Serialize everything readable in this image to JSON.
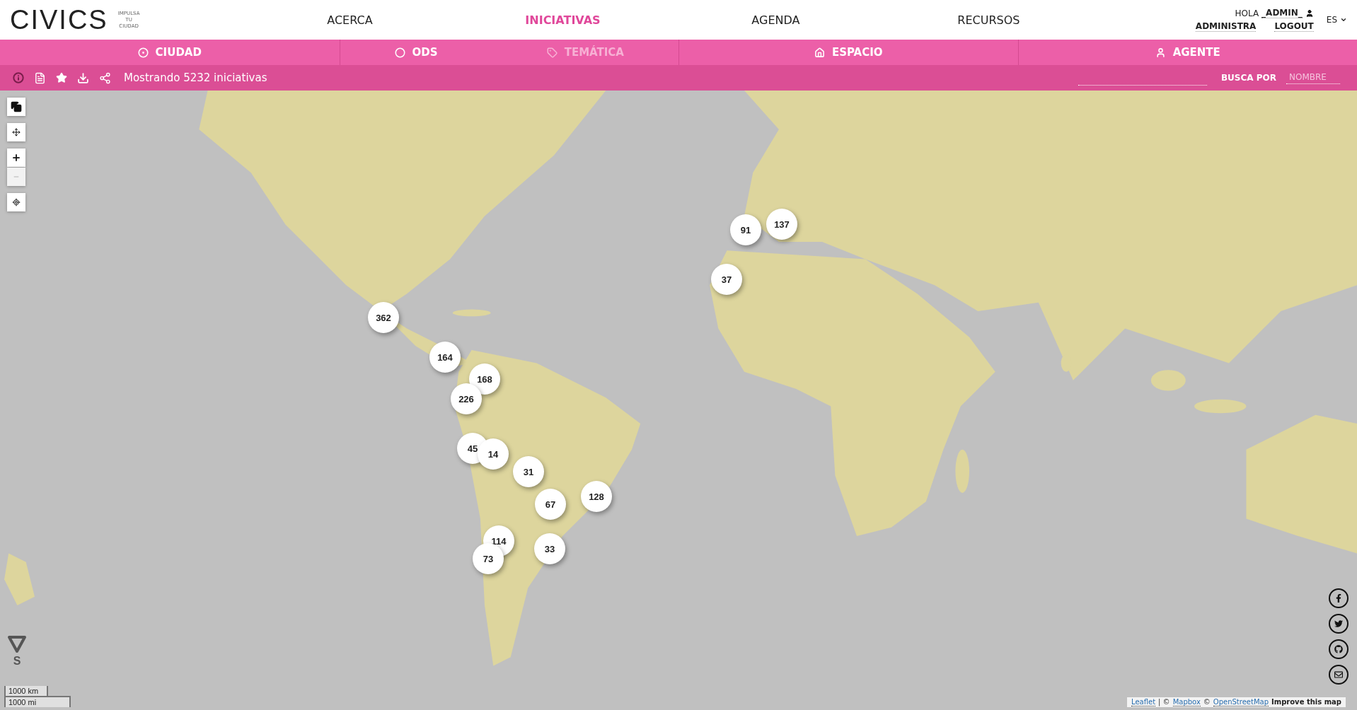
{
  "header": {
    "logo": "CIVICS",
    "tagline": [
      "IMPULSA",
      "TU",
      "CIUDAD"
    ],
    "nav": [
      {
        "label": "ACERCA",
        "selected": false
      },
      {
        "label": "INICIATIVAS",
        "selected": true
      },
      {
        "label": "AGENDA",
        "selected": false
      },
      {
        "label": "RECURSOS",
        "selected": false
      }
    ],
    "user": {
      "greeting": "HOLA",
      "name": "_ADMIN_",
      "links": [
        "ADMINISTRA",
        "LOGOUT"
      ]
    },
    "language": "ES"
  },
  "filters": [
    [
      {
        "label": "CIUDAD",
        "kind": "city",
        "dimmed": false
      }
    ],
    [
      {
        "label": "ODS",
        "kind": "ods",
        "dimmed": false
      },
      {
        "label": "TEMÁTICA",
        "kind": "topic",
        "dimmed": true
      }
    ],
    [
      {
        "label": "ESPACIO",
        "kind": "space",
        "dimmed": false
      }
    ],
    [
      {
        "label": "AGENTE",
        "kind": "agent",
        "dimmed": false
      }
    ]
  ],
  "toolbar": {
    "count": "Mostrando 5232 iniciativas",
    "search_label": "BUSCA POR",
    "search_by": "NOMBRE"
  },
  "map": {
    "clusters": [
      "362",
      "164",
      "168",
      "226",
      "45",
      "14",
      "31",
      "67",
      "128",
      "114",
      "73",
      "33",
      "91",
      "137",
      "37"
    ],
    "compass": "S",
    "scale": [
      "1000 km",
      "1000 mi"
    ],
    "attribution": {
      "links": [
        "Leaflet",
        "Mapbox",
        "OpenStreetMap"
      ],
      "separators": [
        "| ©",
        "©"
      ],
      "improve": "Improve this map"
    }
  }
}
